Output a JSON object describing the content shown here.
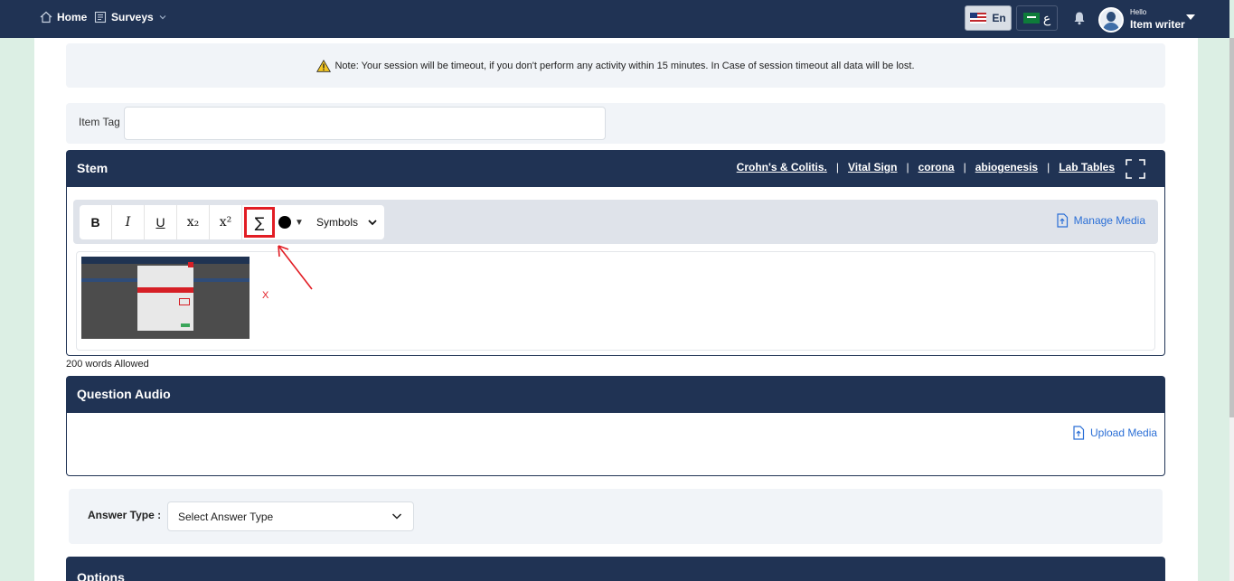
{
  "nav": {
    "home_label": "Home",
    "surveys_label": "Surveys",
    "lang_en": "En",
    "lang_ar": "ع",
    "user_greeting": "Hello",
    "user_name": "Item writer"
  },
  "notice": {
    "text": "Note: Your session will be timeout, if you don't perform any activity within 15 minutes. In Case of session timeout all data will be lost."
  },
  "item_tag": {
    "label": "Item Tag",
    "value": ""
  },
  "stem": {
    "title": "Stem",
    "links": [
      "Crohn's & Colitis.",
      "Vital Sign",
      "corona",
      "abiogenesis",
      "Lab Tables"
    ],
    "separator": "|",
    "toolbar": {
      "bold": "B",
      "italic": "I",
      "underline": "U",
      "subscript": "x₂",
      "superscript": "x²",
      "sum": "∑",
      "color_caret": "▼",
      "symbols": "Symbols"
    },
    "manage_media": "Manage Media",
    "remove_image": "X",
    "words_allowed": "200 words Allowed"
  },
  "question_audio": {
    "title": "Question Audio",
    "upload_media": "Upload Media"
  },
  "answer_type": {
    "label": "Answer Type :",
    "selected": "Select Answer Type"
  },
  "options": {
    "title": "Options"
  },
  "colors": {
    "navy": "#203354",
    "accent_link": "#2b6fd6",
    "highlight_red": "#e21d24",
    "panel_bg": "#f1f4f8",
    "page_bg": "#dcefe4"
  }
}
